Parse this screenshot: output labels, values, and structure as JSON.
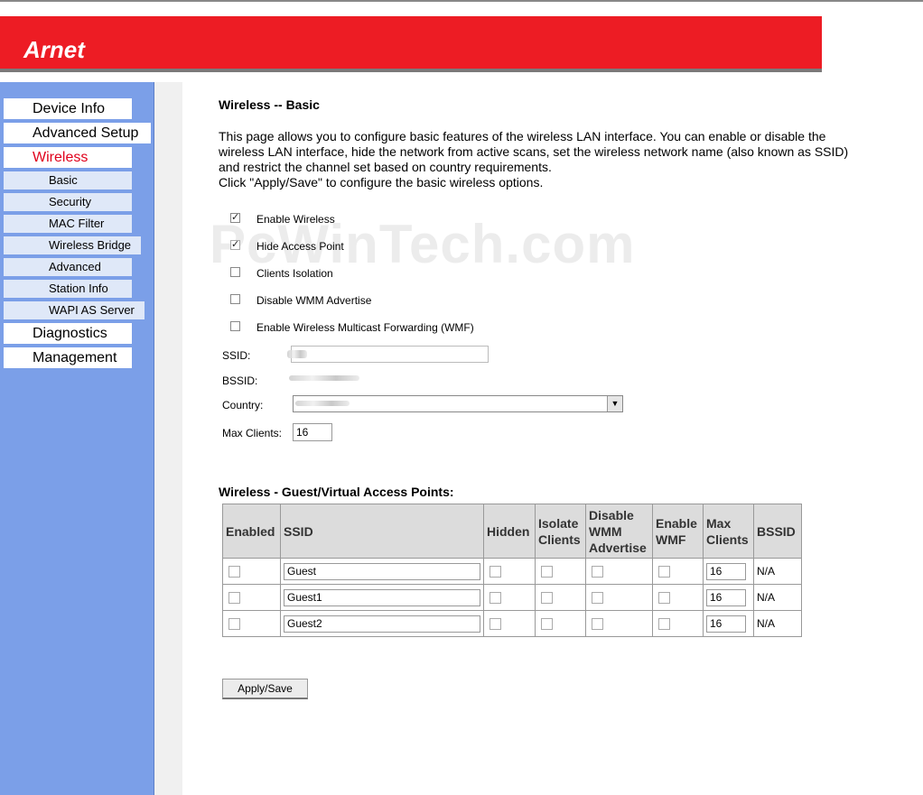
{
  "brand": {
    "logo_text": "Arnet",
    "header_color": "#ed1c24"
  },
  "sidebar": {
    "items": [
      {
        "label": "Device Info",
        "level": "main"
      },
      {
        "label": "Advanced Setup",
        "level": "main"
      },
      {
        "label": "Wireless",
        "level": "main",
        "active": true
      },
      {
        "label": "Basic",
        "level": "sub"
      },
      {
        "label": "Security",
        "level": "sub"
      },
      {
        "label": "MAC Filter",
        "level": "sub"
      },
      {
        "label": "Wireless Bridge",
        "level": "sub"
      },
      {
        "label": "Advanced",
        "level": "sub"
      },
      {
        "label": "Station Info",
        "level": "sub"
      },
      {
        "label": "WAPI AS Server",
        "level": "sub"
      },
      {
        "label": "Diagnostics",
        "level": "main"
      },
      {
        "label": "Management",
        "level": "main"
      }
    ]
  },
  "page": {
    "title": "Wireless -- Basic",
    "description": "This page allows you to configure basic features of the wireless LAN interface. You can enable or disable the wireless LAN interface, hide the network from active scans, set the wireless network name (also known as SSID) and restrict the channel set based on country requirements.",
    "instruction": "Click \"Apply/Save\" to configure the basic wireless options.",
    "watermark": "PcWinTech.com"
  },
  "options": [
    {
      "label": "Enable Wireless",
      "checked": true
    },
    {
      "label": "Hide Access Point",
      "checked": true
    },
    {
      "label": "Clients Isolation",
      "checked": false
    },
    {
      "label": "Disable WMM Advertise",
      "checked": false
    },
    {
      "label": "Enable Wireless Multicast Forwarding (WMF)",
      "checked": false
    }
  ],
  "fields": {
    "ssid_label": "SSID:",
    "bssid_label": "BSSID:",
    "country_label": "Country:",
    "max_clients_label": "Max Clients:",
    "max_clients_value": "16"
  },
  "guest": {
    "title": "Wireless - Guest/Virtual Access Points:",
    "headers": [
      "Enabled",
      "SSID",
      "Hidden",
      "Isolate Clients",
      "Disable WMM Advertise",
      "Enable WMF",
      "Max Clients",
      "BSSID"
    ],
    "rows": [
      {
        "ssid": "Guest",
        "max_clients": "16",
        "bssid": "N/A"
      },
      {
        "ssid": "Guest1",
        "max_clients": "16",
        "bssid": "N/A"
      },
      {
        "ssid": "Guest2",
        "max_clients": "16",
        "bssid": "N/A"
      }
    ]
  },
  "actions": {
    "apply_label": "Apply/Save"
  }
}
